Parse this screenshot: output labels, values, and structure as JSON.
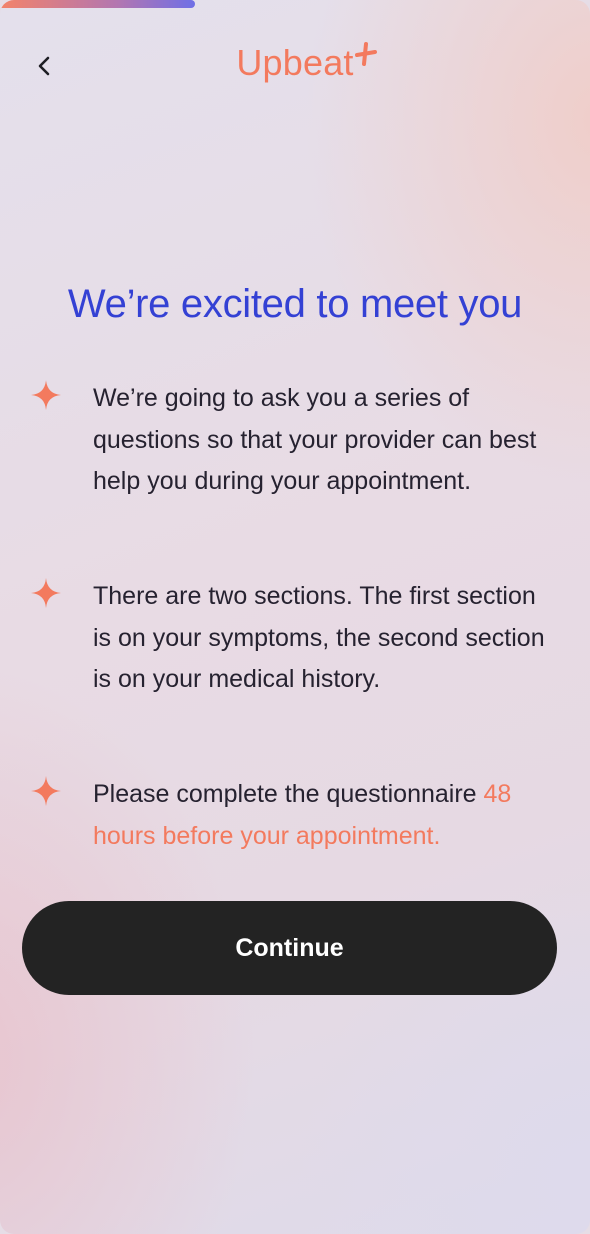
{
  "progress": {
    "fraction": 0.33,
    "colors": [
      "#f3836a",
      "#6f6fe6"
    ]
  },
  "header": {
    "back_icon": "chevron-left-icon",
    "logo_text": "Upbeat",
    "logo_icon": "plus-icon",
    "brand_color": "#f37a5e"
  },
  "main": {
    "title": "We’re excited to meet you",
    "title_color": "#3441d4",
    "items": [
      {
        "icon": "sparkle-icon",
        "text": "We’re going to ask you a series of questions so that your provider can best help you during your appointment."
      },
      {
        "icon": "sparkle-icon",
        "text": "There are two sections. The first section is on your symptoms, the second section is on your medical history."
      },
      {
        "icon": "sparkle-icon",
        "text": "Please complete the questionnaire ",
        "highlight": "48 hours before your appointment."
      }
    ]
  },
  "continue_button": {
    "label": "Continue",
    "background": "#232323"
  }
}
